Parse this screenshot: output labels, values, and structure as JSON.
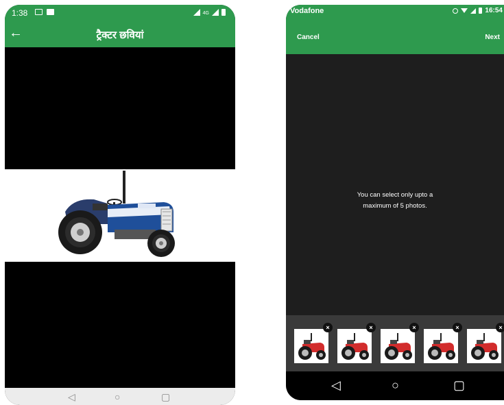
{
  "left_phone": {
    "status": {
      "time": "1:38",
      "network": "4G"
    },
    "appbar": {
      "back_icon": "arrow-left-icon",
      "title": "ट्रैक्टर छवियां"
    },
    "nav": {
      "back": "◁",
      "home": "○",
      "recents": "▢"
    }
  },
  "right_phone": {
    "status": {
      "carrier": "Vodafone",
      "time": "16:54"
    },
    "toolbar": {
      "cancel_label": "Cancel",
      "next_label": "Next"
    },
    "message_line1": "You can select only upto a",
    "message_line2": "maximum of 5 photos.",
    "thumbnails": [
      {
        "remove": "×"
      },
      {
        "remove": "×"
      },
      {
        "remove": "×"
      },
      {
        "remove": "×"
      },
      {
        "remove": "×"
      }
    ],
    "nav": {
      "back": "◁",
      "home": "○",
      "recents": "▢"
    }
  },
  "colors": {
    "accent_green": "#2e9a4e",
    "tractor_blue": "#1f4f9a",
    "tractor_red": "#d22c2c"
  }
}
